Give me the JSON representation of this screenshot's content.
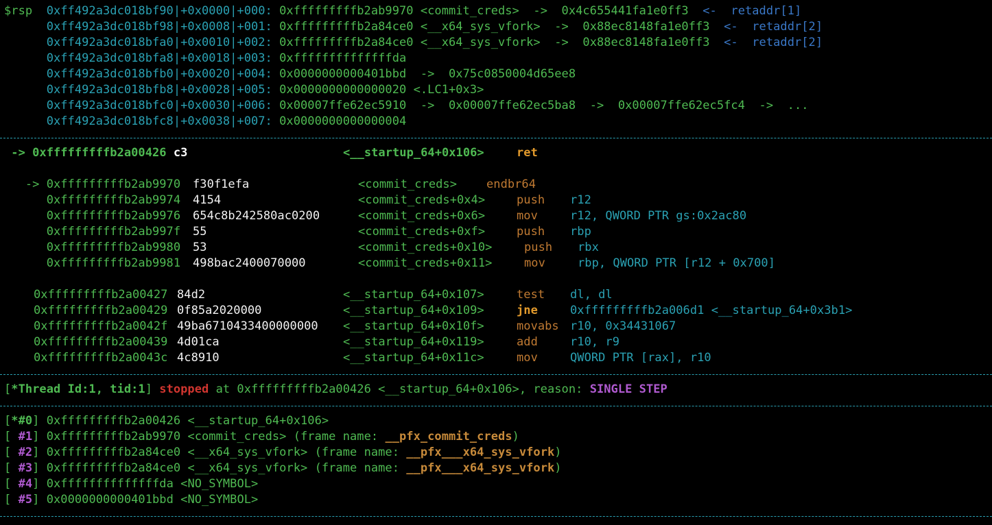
{
  "stack": [
    {
      "prefix": "$rsp  ",
      "addr": "0xff492a3dc018bf90",
      "offset": "|+0x0000|+000: ",
      "value": "0xfffffffffb2ab9970",
      "sym": " <commit_creds>  ->  ",
      "deref": "0x4c655441fa1e0ff3",
      "arrow": "  <-  ",
      "tag": "retaddr[1]"
    },
    {
      "prefix": "      ",
      "addr": "0xff492a3dc018bf98",
      "offset": "|+0x0008|+001: ",
      "value": "0xfffffffffb2a84ce0",
      "sym": " <__x64_sys_vfork>  ->  ",
      "deref": "0x88ec8148fa1e0ff3",
      "arrow": "  <-  ",
      "tag": "retaddr[2]"
    },
    {
      "prefix": "      ",
      "addr": "0xff492a3dc018bfa0",
      "offset": "|+0x0010|+002: ",
      "value": "0xfffffffffb2a84ce0",
      "sym": " <__x64_sys_vfork>  ->  ",
      "deref": "0x88ec8148fa1e0ff3",
      "arrow": "  <-  ",
      "tag": "retaddr[2]"
    },
    {
      "prefix": "      ",
      "addr": "0xff492a3dc018bfa8",
      "offset": "|+0x0018|+003: ",
      "value": "0xffffffffffffffda",
      "sym": "",
      "deref": "",
      "arrow": "",
      "tag": ""
    },
    {
      "prefix": "      ",
      "addr": "0xff492a3dc018bfb0",
      "offset": "|+0x0020|+004: ",
      "value": "0x0000000000401bbd",
      "sym": "  ->  ",
      "deref": "0x75c0850004d65ee8",
      "arrow": "",
      "tag": ""
    },
    {
      "prefix": "      ",
      "addr": "0xff492a3dc018bfb8",
      "offset": "|+0x0028|+005: ",
      "value": "0x0000000000000020",
      "sym": " <.LC1+0x3>",
      "deref": "",
      "arrow": "",
      "tag": ""
    },
    {
      "prefix": "      ",
      "addr": "0xff492a3dc018bfc0",
      "offset": "|+0x0030|+006: ",
      "value": "0x00007ffe62ec5910",
      "sym": "  ->  ",
      "deref": "0x00007ffe62ec5ba8  ->  0x00007ffe62ec5fc4  ->  ...",
      "arrow": "",
      "tag": ""
    },
    {
      "prefix": "      ",
      "addr": "0xff492a3dc018bfc8",
      "offset": "|+0x0038|+007: ",
      "value": "0x0000000000000004",
      "sym": "",
      "deref": "",
      "arrow": "",
      "tag": ""
    }
  ],
  "current": {
    "arrow": " -> ",
    "addr": "0xfffffffffb2a00426",
    "bytes": " c3",
    "sym": "<__startup_64+0x106>",
    "mnem": "ret"
  },
  "branch": [
    {
      "arrow": "   -> ",
      "addr": "0xfffffffffb2ab9970",
      "bytes": "f30f1efa",
      "sym": "<commit_creds>",
      "mnem": "endbr64",
      "ops": ""
    },
    {
      "arrow": "      ",
      "addr": "0xfffffffffb2ab9974",
      "bytes": "4154",
      "sym": "<commit_creds+0x4>",
      "mnem": "push",
      "ops": "r12"
    },
    {
      "arrow": "      ",
      "addr": "0xfffffffffb2ab9976",
      "bytes": "654c8b242580ac0200",
      "sym": "<commit_creds+0x6>",
      "mnem": "mov",
      "ops": "r12, QWORD PTR gs:0x2ac80"
    },
    {
      "arrow": "      ",
      "addr": "0xfffffffffb2ab997f",
      "bytes": "55",
      "sym": "<commit_creds+0xf>",
      "mnem": "push",
      "ops": "rbp"
    },
    {
      "arrow": "      ",
      "addr": "0xfffffffffb2ab9980",
      "bytes": "53",
      "sym": "<commit_creds+0x10>",
      "mnem": "push",
      "ops": "rbx"
    },
    {
      "arrow": "      ",
      "addr": "0xfffffffffb2ab9981",
      "bytes": "498bac2400070000",
      "sym": "<commit_creds+0x11>",
      "mnem": "mov",
      "ops": "rbp, QWORD PTR [r12 + 0x700]"
    }
  ],
  "next": [
    {
      "addr": "0xfffffffffb2a00427",
      "bytes": "84d2",
      "sym": "<__startup_64+0x107>",
      "mnem": "test",
      "ops": "dl, dl"
    },
    {
      "addr": "0xfffffffffb2a00429",
      "bytes": "0f85a2020000",
      "sym": "<__startup_64+0x109>",
      "mnem": "jne",
      "ops": "0xfffffffffb2a006d1 <__startup_64+0x3b1>"
    },
    {
      "addr": "0xfffffffffb2a0042f",
      "bytes": "49ba6710433400000000",
      "sym": "<__startup_64+0x10f>",
      "mnem": "movabs",
      "ops": "r10, 0x34431067"
    },
    {
      "addr": "0xfffffffffb2a00439",
      "bytes": "4d01ca",
      "sym": "<__startup_64+0x119>",
      "mnem": "add",
      "ops": "r10, r9"
    },
    {
      "addr": "0xfffffffffb2a0043c",
      "bytes": "4c8910",
      "sym": "<__startup_64+0x11c>",
      "mnem": "mov",
      "ops": "QWORD PTR [rax], r10"
    }
  ],
  "thread": {
    "open": "[",
    "id": "*Thread Id:1, tid:1",
    "close": "] ",
    "state": "stopped",
    "at": " at 0xfffffffffb2a00426 <__startup_64+0x106>, reason: ",
    "reason": "SINGLE STEP"
  },
  "trace": [
    {
      "open": "[",
      "idx": "*#0",
      "close": "] ",
      "addr": "0xfffffffffb2a00426",
      "sym": " <__startup_64+0x106>",
      "fn_pre": "",
      "fn": "",
      "fn_post": ""
    },
    {
      "open": "[ ",
      "idx": "#1",
      "close": "] ",
      "addr": "0xfffffffffb2ab9970",
      "sym": " <commit_creds>",
      "fn_pre": " (frame name: ",
      "fn": "__pfx_commit_creds",
      "fn_post": ")"
    },
    {
      "open": "[ ",
      "idx": "#2",
      "close": "] ",
      "addr": "0xfffffffffb2a84ce0",
      "sym": " <__x64_sys_vfork>",
      "fn_pre": " (frame name: ",
      "fn": "__pfx___x64_sys_vfork",
      "fn_post": ")"
    },
    {
      "open": "[ ",
      "idx": "#3",
      "close": "] ",
      "addr": "0xfffffffffb2a84ce0",
      "sym": " <__x64_sys_vfork>",
      "fn_pre": " (frame name: ",
      "fn": "__pfx___x64_sys_vfork",
      "fn_post": ")"
    },
    {
      "open": "[ ",
      "idx": "#4",
      "close": "] ",
      "addr": "0xffffffffffffffda",
      "sym": " <NO_SYMBOL>",
      "fn_pre": "",
      "fn": "",
      "fn_post": ""
    },
    {
      "open": "[ ",
      "idx": "#5",
      "close": "] ",
      "addr": "0x0000000000401bbd",
      "sym": " <NO_SYMBOL>",
      "fn_pre": "",
      "fn": "",
      "fn_post": ""
    }
  ],
  "colors": {
    "green": "#4fba52",
    "cyan": "#2aa1b3",
    "blue": "#3a78c8",
    "orange": "#c07a32",
    "red": "#d0352f",
    "magenta": "#b05ad0",
    "background": "#000000"
  }
}
